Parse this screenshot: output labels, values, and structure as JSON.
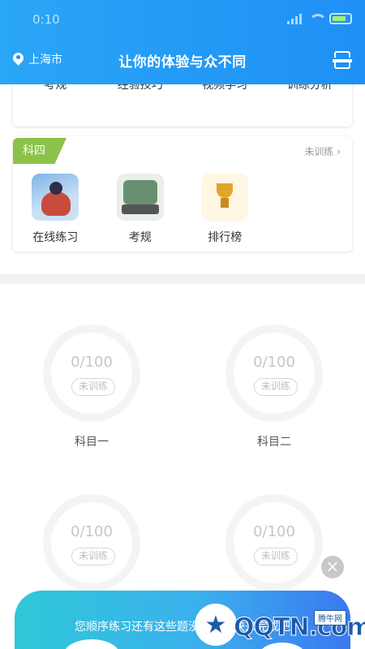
{
  "status": {
    "time": "0:10"
  },
  "header": {
    "location": "上海市",
    "slogan": "让你的体验与众不同"
  },
  "card1": {
    "items": [
      {
        "label": "考规"
      },
      {
        "label": "经验技巧"
      },
      {
        "label": "视频学习"
      },
      {
        "label": "训练分析"
      }
    ]
  },
  "card2": {
    "tag": "科四",
    "status_link": "未训练",
    "items": [
      {
        "label": "在线练习"
      },
      {
        "label": "考规"
      },
      {
        "label": "排行榜"
      }
    ]
  },
  "progress": [
    {
      "count": "0/100",
      "status": "未训练",
      "name": "科目一"
    },
    {
      "count": "0/100",
      "status": "未训练",
      "name": "科目二"
    },
    {
      "count": "0/100",
      "status": "未训练"
    },
    {
      "count": "0/100",
      "status": "未训练"
    }
  ],
  "banner": {
    "text": "您顺序练习还有这些题没有做，快来完成吧"
  },
  "watermark": {
    "text": "QQTN.com",
    "box": "腾牛网"
  },
  "colors": {
    "header_start": "#2aa6f6",
    "header_end": "#1e90f5",
    "tag": "#8bc34a"
  }
}
